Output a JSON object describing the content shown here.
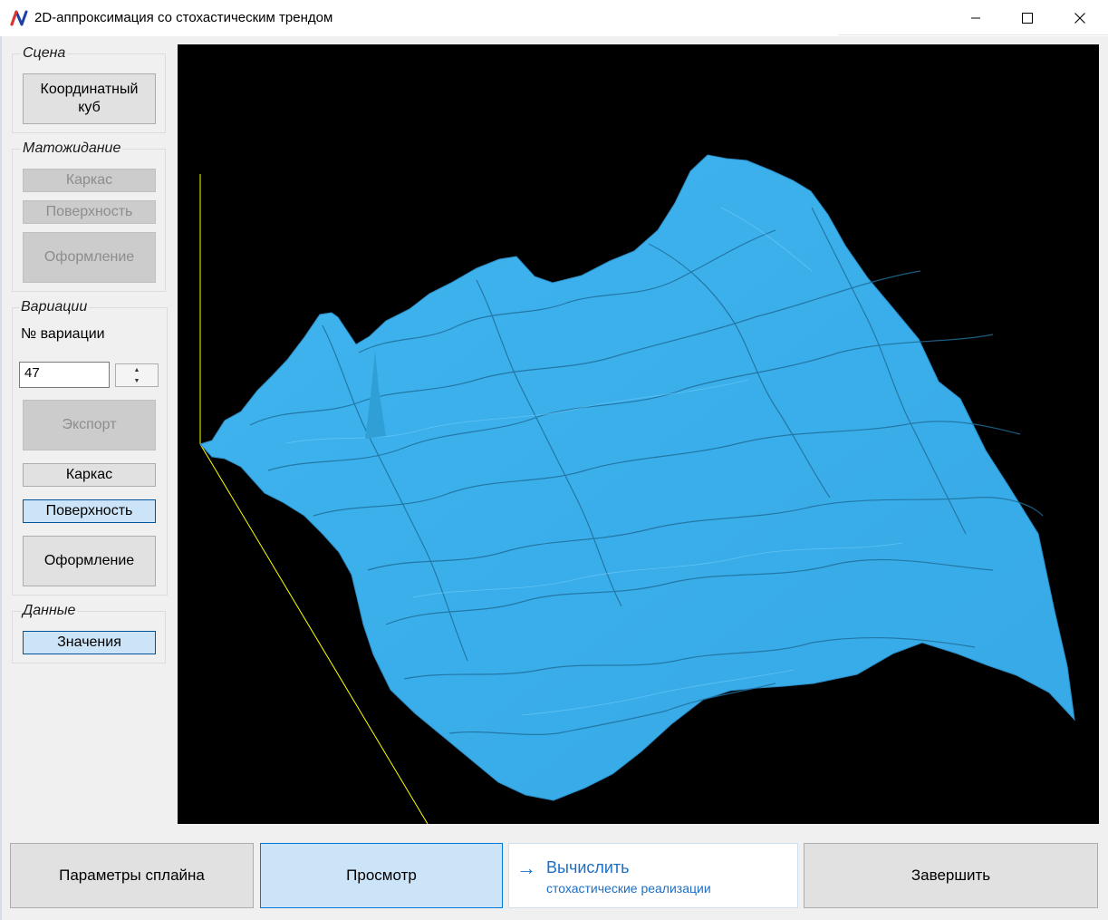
{
  "window": {
    "title": "2D-аппроксимация со стохастическим трендом",
    "controls": [
      "minimize",
      "maximize",
      "close"
    ]
  },
  "colors": {
    "surface": "#3fb4ee",
    "surface_dark": "#1d6a96",
    "axis": "#ffff00",
    "viewport_bg": "#000000",
    "selected_bg": "#cce4f7",
    "accent": "#1c6fc8"
  },
  "sidebar": {
    "scene": {
      "legend": "Сцена",
      "coord_cube": "Координатный куб"
    },
    "expectation": {
      "legend": "Матожидание",
      "frame": "Каркас",
      "surface": "Поверхность",
      "design": "Оформление"
    },
    "variations": {
      "legend": "Вариации",
      "number_label": "№ вариации",
      "number_value": "47",
      "export": "Экспорт",
      "frame": "Каркас",
      "surface": "Поверхность",
      "design": "Оформление"
    },
    "data": {
      "legend": "Данные",
      "values": "Значения"
    }
  },
  "bottom": {
    "spline_params": "Параметры сплайна",
    "view": "Просмотр",
    "compute_main": "Вычислить",
    "compute_sub": "стохастические реализации",
    "finish": "Завершить"
  },
  "icons": {
    "app": "app-logo-icon",
    "minimize": "minimize-icon",
    "maximize": "maximize-icon",
    "close": "close-icon",
    "arrow": "arrow-right-icon",
    "spin_up": "spin-up-icon",
    "spin_down": "spin-down-icon"
  }
}
